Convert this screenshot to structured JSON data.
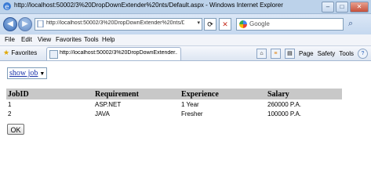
{
  "window": {
    "title": "http://localhost:50002/3%20DropDownExtender%20nts/Default.aspx - Windows Internet Explorer",
    "close_glyph": "✕",
    "min_glyph": "–",
    "max_glyph": "□"
  },
  "address_bar": {
    "url": "http://localhost:50002/3%20DropDownExtender%20nts/Defau",
    "back_glyph": "◀",
    "forward_glyph": "▶",
    "dropdown_glyph": "▾",
    "refresh_glyph": "⟳",
    "stop_glyph": "✕"
  },
  "search_box": {
    "placeholder": "Google",
    "button_glyph": "⌕"
  },
  "menu": [
    "File",
    "Edit",
    "View",
    "Favorites",
    "Tools",
    "Help"
  ],
  "command_bar": {
    "favorites_label": "Favorites",
    "tab_title": "http://localhost:50002/3%20DropDownExtender...",
    "items": [
      "Page",
      "Safety",
      "Tools"
    ]
  },
  "page": {
    "show_job_label": "show job",
    "table": {
      "headers": [
        "JobID",
        "Requirement",
        "Experience",
        "Salary"
      ],
      "rows": [
        [
          "1",
          "ASP.NET",
          "1 Year",
          "260000 P.A."
        ],
        [
          "2",
          "JAVA",
          "Fresher",
          "100000 P.A."
        ]
      ]
    },
    "ok_label": "OK"
  },
  "colors": {
    "titlebar": "#bcd2ea",
    "link": "#1a33aa",
    "table_header": "#c8c8c8"
  },
  "icons": [
    "ie-icon",
    "back-icon",
    "forward-icon",
    "page-icon",
    "refresh-icon",
    "stop-icon",
    "google-icon",
    "search-icon",
    "star-icon",
    "home-icon",
    "feeds-icon",
    "print-icon",
    "help-icon"
  ]
}
